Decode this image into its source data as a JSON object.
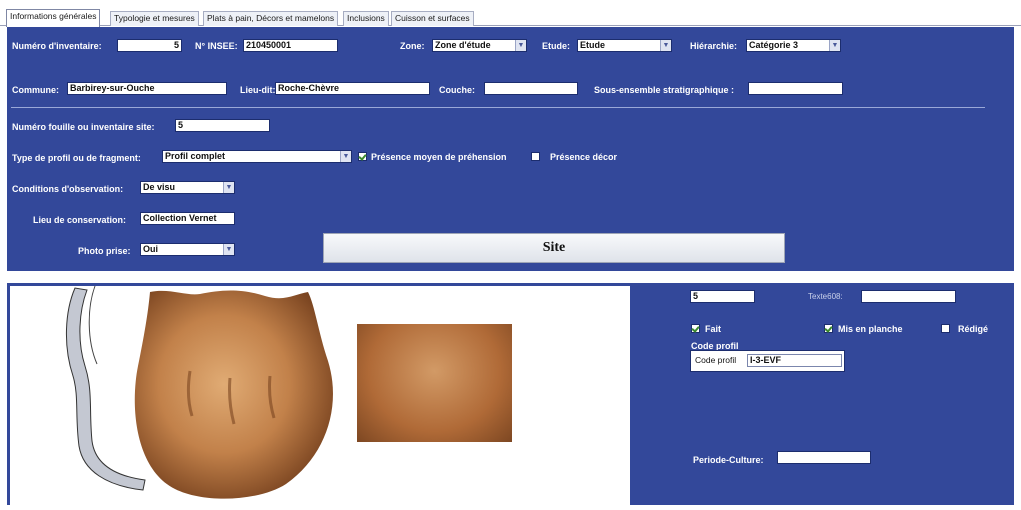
{
  "tabs": [
    {
      "label": "Informations générales"
    },
    {
      "label": "Typologie et mesures"
    },
    {
      "label": "Plats à pain, Décors et mamelons"
    },
    {
      "label": "Inclusions"
    },
    {
      "label": "Cuisson et surfaces"
    }
  ],
  "form": {
    "inventaire_label": "Numéro d'inventaire:",
    "inventaire_value": "5",
    "insee_label": "N° INSEE:",
    "insee_value": "210450001",
    "zone_label": "Zone:",
    "zone_value": "Zone d'étude",
    "etude_label": "Etude:",
    "etude_value": "Etude",
    "hierarchie_label": "Hiérarchie:",
    "hierarchie_value": "Catégorie 3",
    "commune_label": "Commune:",
    "commune_value": "Barbirey-sur-Ouche",
    "lieudit_label": "Lieu-dit:",
    "lieudit_value": "Roche-Chèvre",
    "couche_label": "Couche:",
    "couche_value": "",
    "sous_ensemble_label": "Sous-ensemble stratigraphique :",
    "sous_ensemble_value": "",
    "fouille_label": "Numéro fouille ou inventaire site:",
    "fouille_value": "5",
    "profil_label": "Type de profil ou de fragment:",
    "profil_value": "Profil complet",
    "prehension_label": "Présence moyen de préhension",
    "prehension_checked": true,
    "decor_label": "Présence décor",
    "decor_checked": false,
    "observation_label": "Conditions d'observation:",
    "observation_value": "De visu",
    "conservation_label": "Lieu de conservation:",
    "conservation_value": "Collection Vernet",
    "photo_label": "Photo prise:",
    "photo_value": "Oui",
    "site_button": "Site"
  },
  "lower": {
    "num_value": "5",
    "texte_label": "Texte608:",
    "texte_value": "",
    "fait_label": "Fait",
    "fait_checked": true,
    "planche_label": "Mis en planche",
    "planche_checked": true,
    "redige_label": "Rédigé",
    "redige_checked": false,
    "code_profil_title": "Code profil",
    "code_profil_label": "Code profil",
    "code_profil_value": "I-3-EVF",
    "periode_label": "Periode-Culture:",
    "periode_value": ""
  },
  "colors": {
    "form_background": "#33489a",
    "label_text": "#ffffff",
    "checkbox_check": "#3c8a2e"
  }
}
